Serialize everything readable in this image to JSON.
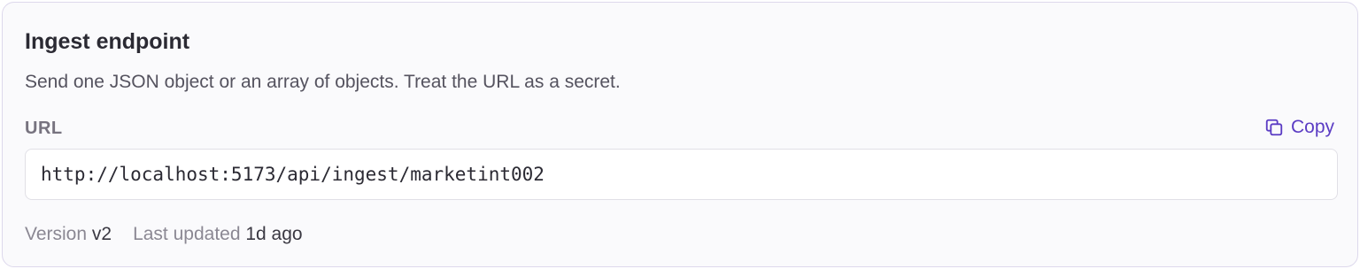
{
  "card": {
    "title": "Ingest endpoint",
    "description": "Send one JSON object or an array of objects. Treat the URL as a secret.",
    "url_label": "URL",
    "copy_label": "Copy",
    "url_value": "http://localhost:5173/api/ingest/marketint002",
    "meta": {
      "version_key": "Version",
      "version_value": "v2",
      "updated_key": "Last updated",
      "updated_value": "1d ago"
    }
  },
  "colors": {
    "accent": "#5b3cc4",
    "border": "#ddd8ec",
    "card_background": "#fafafc"
  },
  "icons": {
    "copy": "copy-icon"
  }
}
